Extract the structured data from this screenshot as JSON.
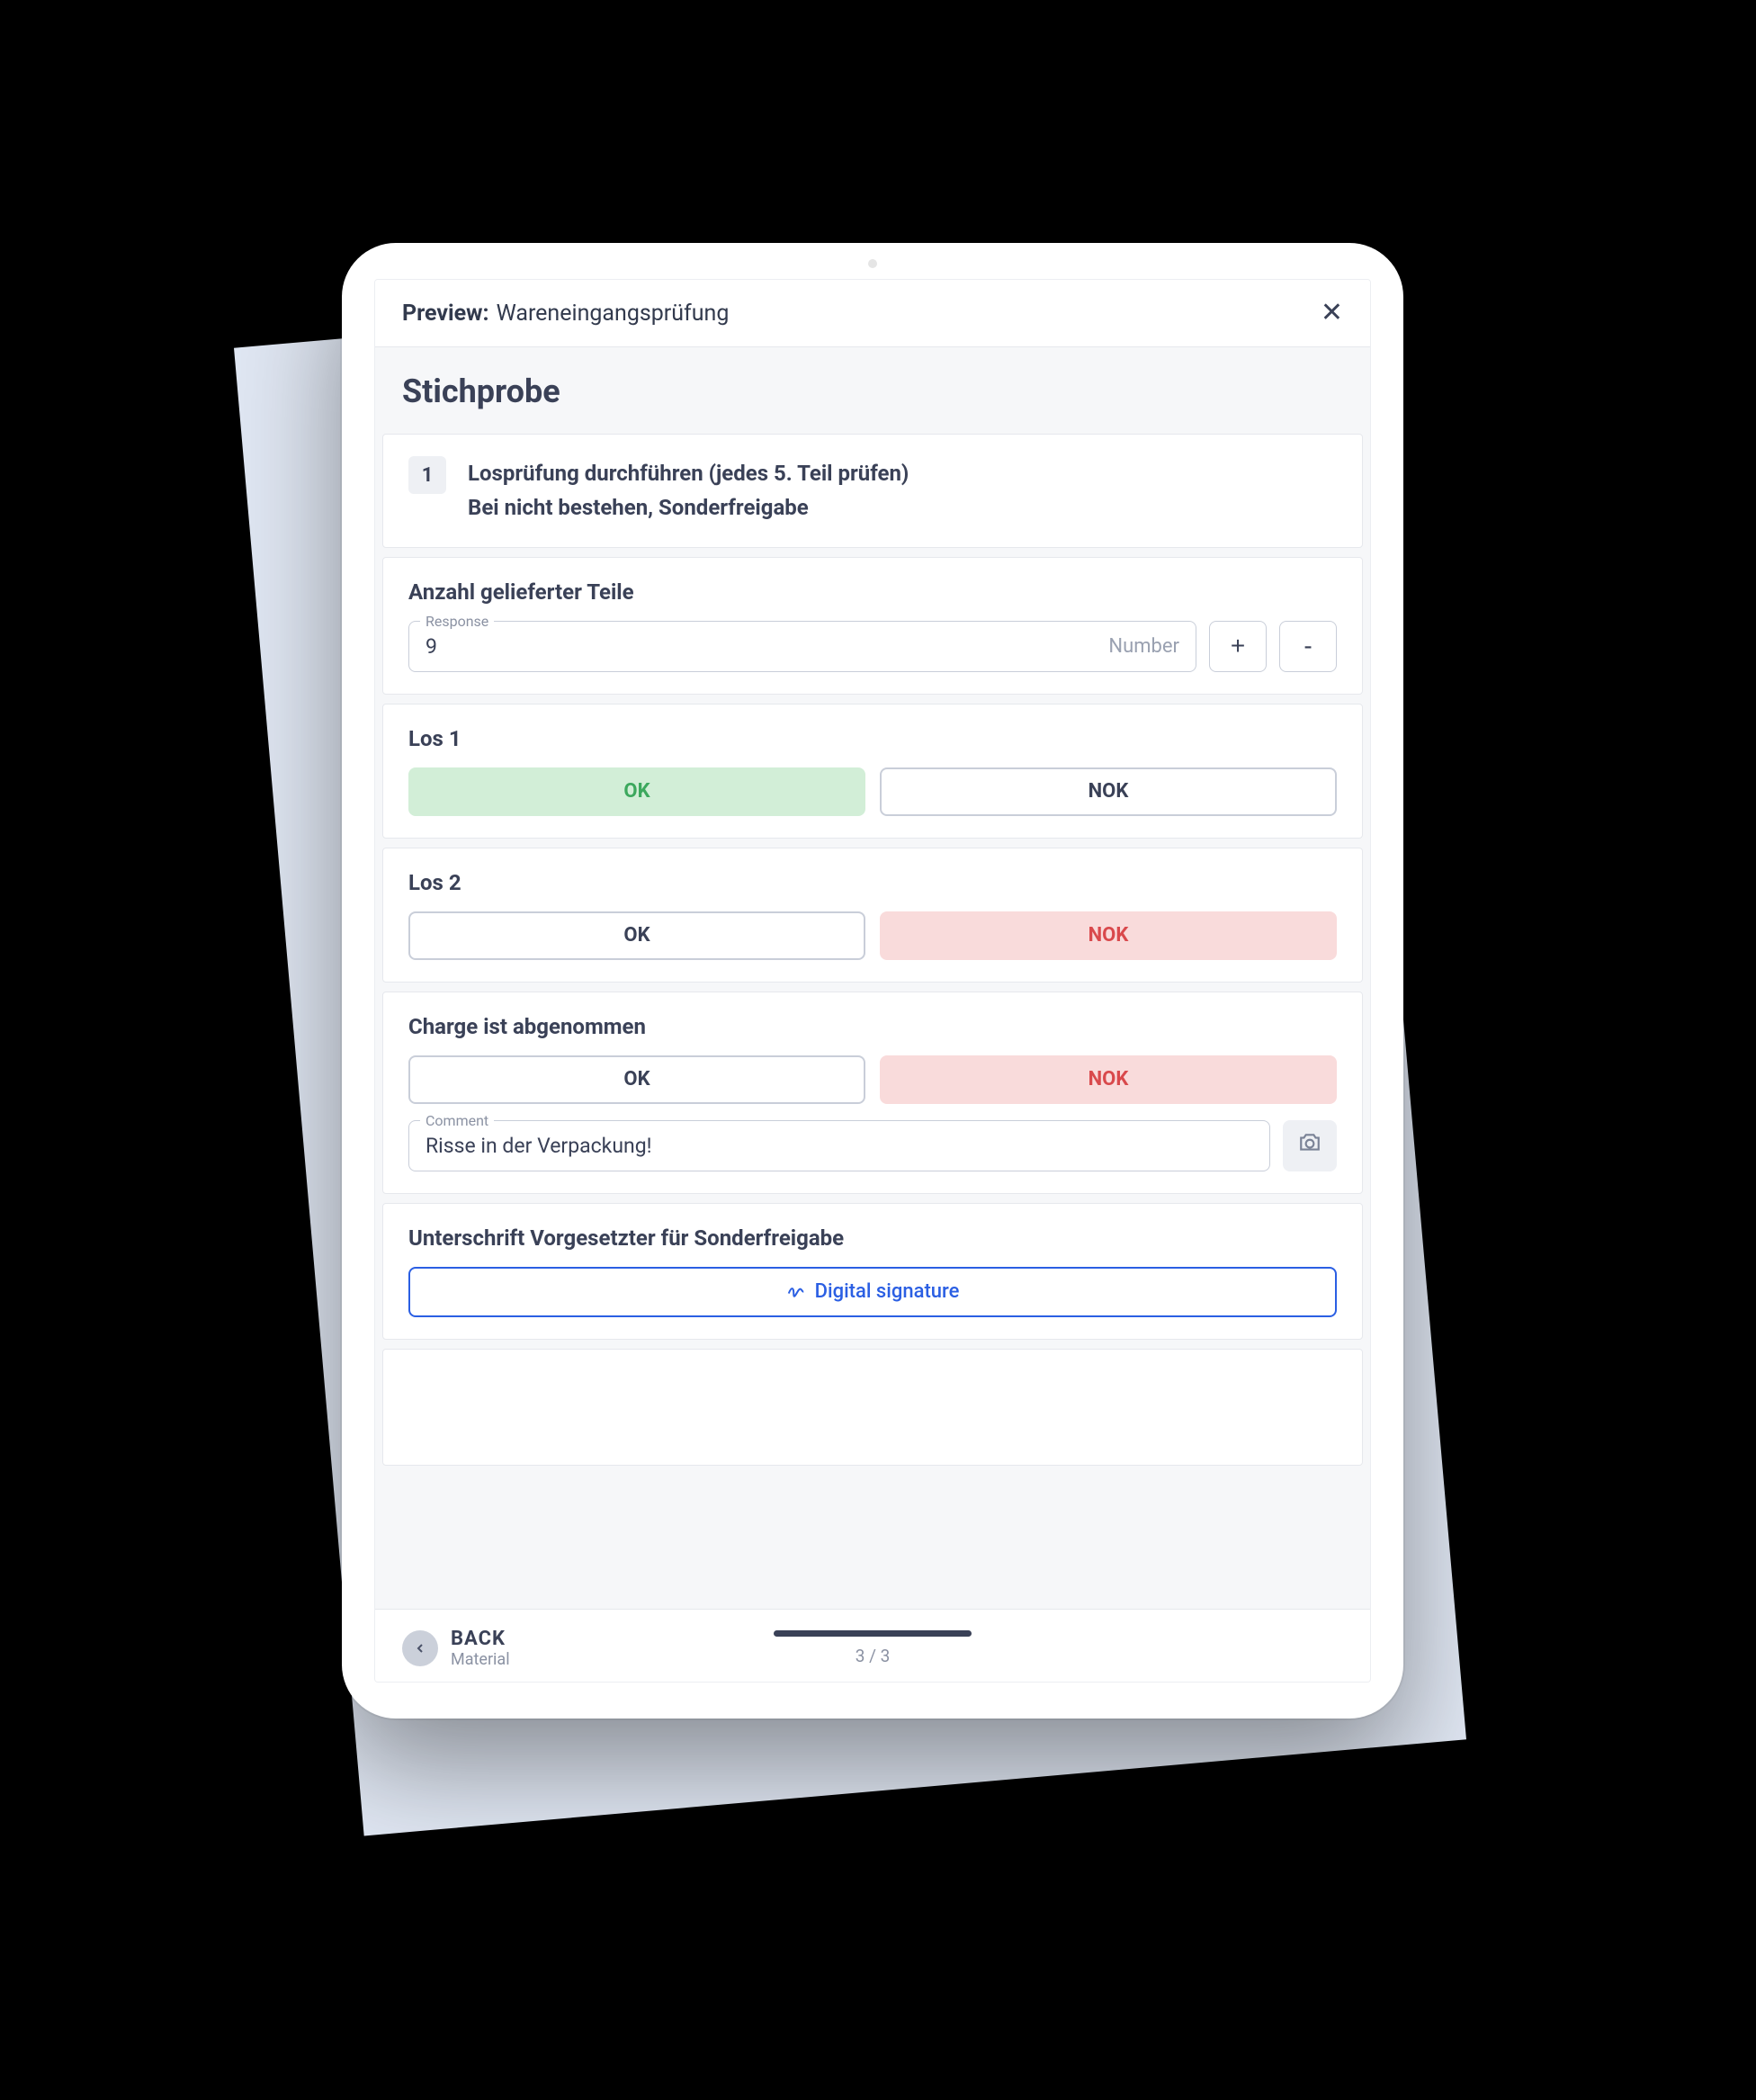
{
  "header": {
    "prefix": "Preview:",
    "title": "Wareneingangsprüfung"
  },
  "page": {
    "title": "Stichprobe"
  },
  "step": {
    "num": "1",
    "line1": "Losprüfung durchführen  (jedes 5. Teil prüfen)",
    "line2": "Bei nicht bestehen, Sonderfreigabe"
  },
  "qty": {
    "label": "Anzahl gelieferter Teile",
    "float": "Response",
    "value": "9",
    "type": "Number",
    "plus": "+",
    "minus": "-"
  },
  "los1": {
    "label": "Los 1",
    "ok": "OK",
    "nok": "NOK",
    "selected": "ok"
  },
  "los2": {
    "label": "Los 2",
    "ok": "OK",
    "nok": "NOK",
    "selected": "nok"
  },
  "charge": {
    "label": "Charge ist abgenommen",
    "ok": "OK",
    "nok": "NOK",
    "selected": "nok",
    "comment_float": "Comment",
    "comment_value": "Risse in der Verpackung!"
  },
  "signature": {
    "label": "Unterschrift Vorgesetzter für Sonderfreigabe",
    "button": "Digital signature"
  },
  "footer": {
    "back": "BACK",
    "back_sub": "Material",
    "progress": "3 / 3"
  }
}
